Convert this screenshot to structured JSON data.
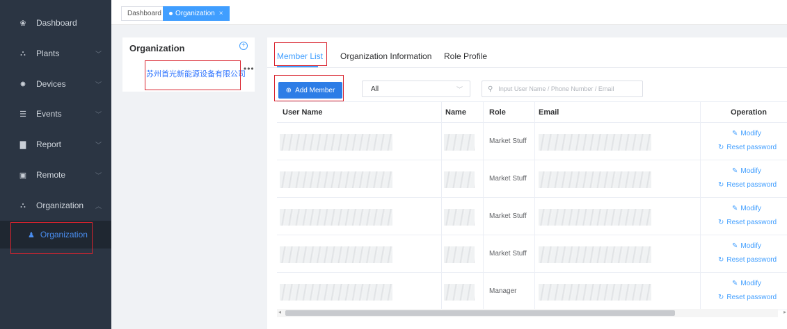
{
  "sidebar": {
    "items": [
      {
        "label": "Dashboard",
        "icon": "dashboard-icon",
        "glyph": "❀"
      },
      {
        "label": "Plants",
        "icon": "plant-icon",
        "glyph": "⛬"
      },
      {
        "label": "Devices",
        "icon": "device-icon",
        "glyph": "✸"
      },
      {
        "label": "Events",
        "icon": "event-icon",
        "glyph": "☰"
      },
      {
        "label": "Report",
        "icon": "report-icon",
        "glyph": "▇"
      },
      {
        "label": "Remote",
        "icon": "remote-icon",
        "glyph": "▣"
      },
      {
        "label": "Organization",
        "icon": "organization-icon",
        "glyph": "⛬"
      }
    ],
    "sub_item": {
      "label": "Organization",
      "glyph": "♟"
    }
  },
  "tags": {
    "dashboard": "Dashboard",
    "active": "Organization",
    "close": "×"
  },
  "org_panel": {
    "title": "Organization",
    "node": "苏州首光新能源设备有限公司",
    "more": "•••",
    "add": "+"
  },
  "tabs": [
    "Member List",
    "Organization Information",
    "Role Profile"
  ],
  "toolbar": {
    "add_member": "Add Member",
    "add_glyph": "⊕",
    "filter_value": "All",
    "search_placeholder": "Input User Name / Phone Number / Email"
  },
  "table": {
    "headers": [
      "User Name",
      "Name",
      "Role",
      "Email",
      "Operation"
    ],
    "rows": [
      {
        "role": "Market Stuff"
      },
      {
        "role": "Market Stuff"
      },
      {
        "role": "Market Stuff"
      },
      {
        "role": "Market Stuff"
      },
      {
        "role": "Manager"
      }
    ],
    "modify_label": "Modify",
    "reset_label": "Reset password"
  },
  "colors": {
    "sidebar": "#2b3543",
    "accent": "#409eff",
    "highlight": "#d9232e"
  }
}
